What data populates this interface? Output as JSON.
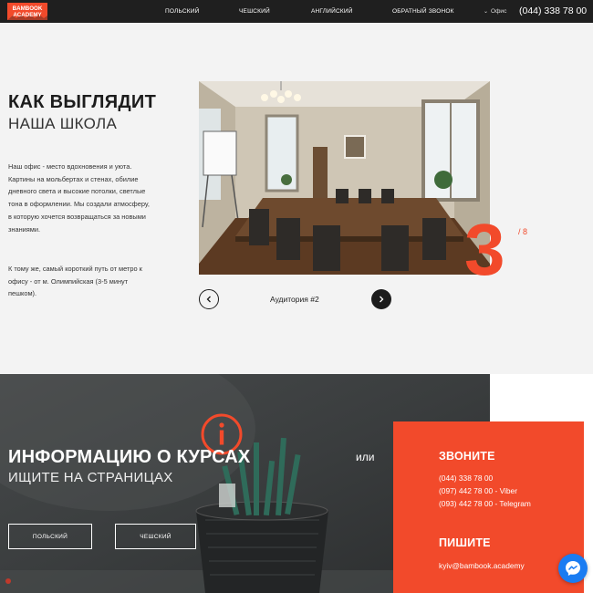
{
  "header": {
    "logo_text_1": "BAMBOOK",
    "logo_text_2": "ACADEMY",
    "nav": [
      "ПОЛЬСКИЙ",
      "ЧЕШСКИЙ",
      "АНГЛИЙСКИЙ",
      "ОБРАТНЫЙ ЗВОНОК"
    ],
    "office_label": "Офис",
    "phone": "(044) 338 78 00"
  },
  "about": {
    "title_strong": "КАК ВЫГЛЯДИТ",
    "title_light": "НАША ШКОЛА",
    "desc_1": "Наш офис - место вдохновения и уюта. Картины на мольбертах и стенах, обилие дневного света и высокие потолки, светлые тона в оформлении. Мы создали атмосферу, в которую хочется возвращаться за новыми знаниями.",
    "desc_2": "К тому же, самый короткий путь от метро к офису - от м. Олимпийская (3-5 минут пешком).",
    "slider": {
      "current": "3",
      "total": "/ 8",
      "caption": "Аудитория #2"
    }
  },
  "courses": {
    "title": "ИНФОРМАЦИЮ О КУРСАХ",
    "subtitle": "ИЩИТЕ НА СТРАНИЦАХ",
    "or_text": "или",
    "buttons": [
      "ПОЛЬСКИЙ",
      "ЧЕШСКИЙ"
    ]
  },
  "contact": {
    "call_heading": "ЗВОНИТЕ",
    "phones": [
      "(044) 338 78 00",
      "(097) 442 78 00 - Viber",
      "(093) 442 78 00 - Telegram"
    ],
    "write_heading": "ПИШИТЕ",
    "email": "kyiv@bambook.academy"
  },
  "colors": {
    "accent": "#f24a2b",
    "header_bg": "#1f1f1f",
    "messenger": "#1a7cf2"
  },
  "icons": [
    "info-icon",
    "chevron-left-icon",
    "chevron-right-icon",
    "messenger-icon",
    "chevron-down-icon"
  ]
}
